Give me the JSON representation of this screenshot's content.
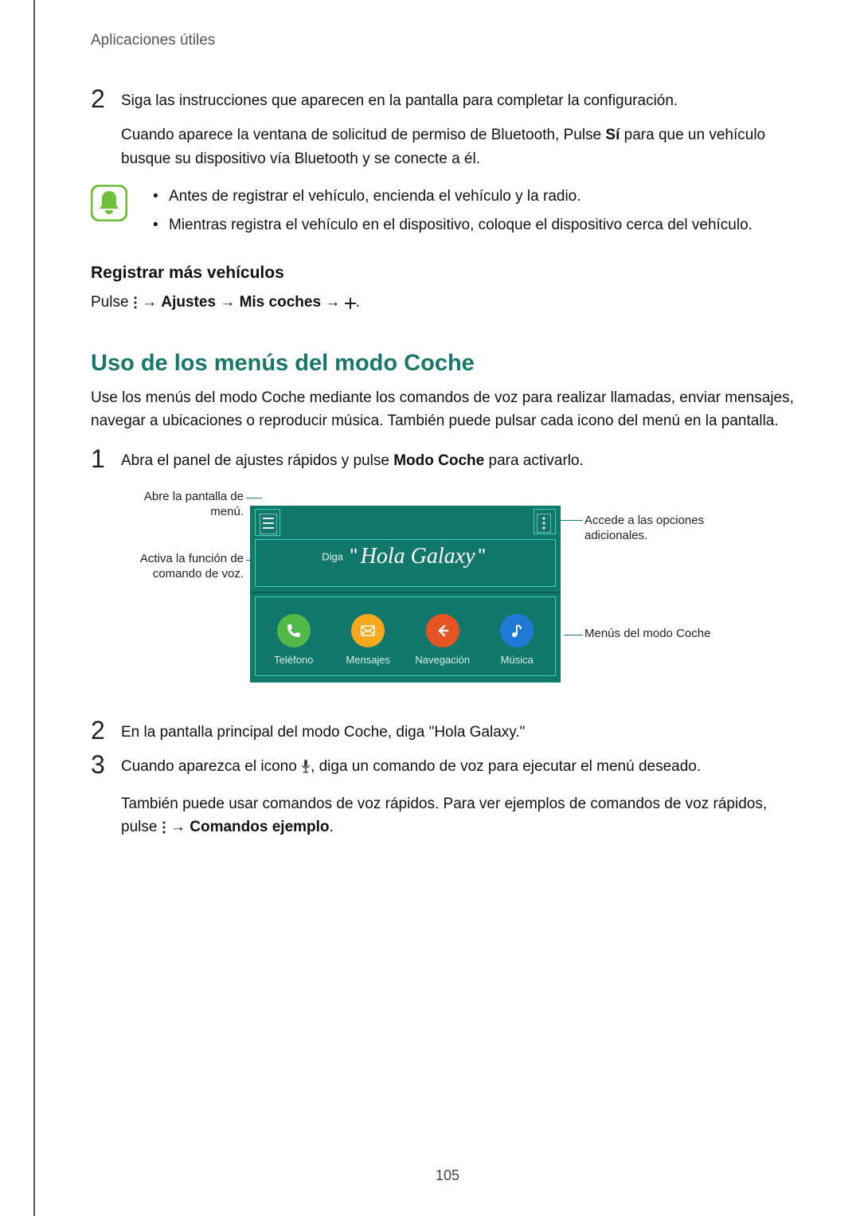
{
  "header": "Aplicaciones útiles",
  "step2": {
    "num": "2",
    "text": "Siga las instrucciones que aparecen en la pantalla para completar la configuración.",
    "para_a": "Cuando aparece la ventana de solicitud de permiso de Bluetooth, Pulse ",
    "para_bold": "Sí",
    "para_b": " para que un vehículo busque su dispositivo vía Bluetooth y se conecte a él."
  },
  "notes": {
    "b1": "Antes de registrar el vehículo, encienda el vehículo y la radio.",
    "b2": "Mientras registra el vehículo en el dispositivo, coloque el dispositivo cerca del vehículo."
  },
  "register": {
    "title": "Registrar más vehículos",
    "pulse": "Pulse ",
    "ajustes": "Ajustes",
    "mis": "Mis coches",
    "dot": "."
  },
  "section": {
    "title": "Uso de los menús del modo Coche",
    "body": "Use los menús del modo Coche mediante los comandos de voz para realizar llamadas, enviar mensajes, navegar a ubicaciones o reproducir música. También puede pulsar cada icono del menú en la pantalla."
  },
  "step1b": {
    "num": "1",
    "a": "Abra el panel de ajustes rápidos y pulse ",
    "bold": "Modo Coche",
    "b": " para activarlo."
  },
  "callouts": {
    "menu": "Abre la pantalla de menú.",
    "voice": "Activa la función de comando de voz.",
    "options": "Accede a las opciones adicionales.",
    "menus": "Menús del modo Coche"
  },
  "screen": {
    "diga": "Diga",
    "hola": "Hola Galaxy",
    "phone": "Teléfono",
    "msg": "Mensajes",
    "nav": "Navegación",
    "music": "Música"
  },
  "step2b": {
    "num": "2",
    "text": "En la pantalla principal del modo Coche, diga \"Hola Galaxy.\""
  },
  "step3": {
    "num": "3",
    "a": "Cuando aparezca el icono ",
    "b": ", diga un comando de voz para ejecutar el menú deseado.",
    "c": "También puede usar comandos de voz rápidos. Para ver ejemplos de comandos de voz rápidos, pulse ",
    "bold": "Comandos ejemplo",
    "d": "."
  },
  "pagenum": "105"
}
